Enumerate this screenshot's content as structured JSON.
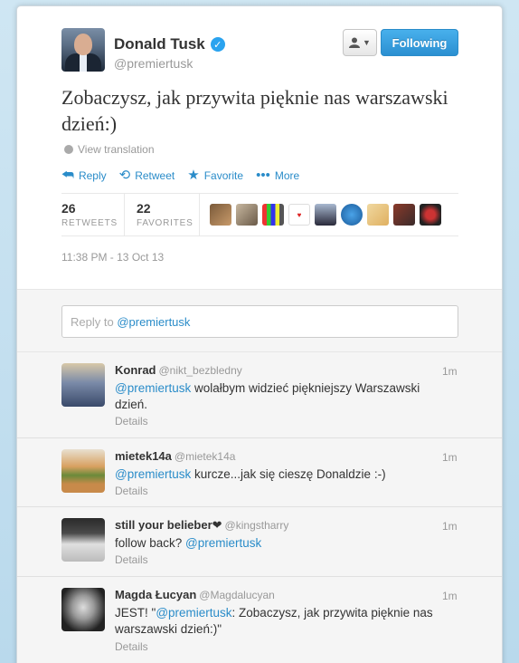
{
  "tweet": {
    "author_name": "Donald Tusk",
    "author_handle": "@premiertusk",
    "verified_mark": "✓",
    "text": "Zobaczysz, jak przywita pięknie nas warszawski dzień:)",
    "view_translation": "View translation",
    "actions": {
      "reply": "Reply",
      "retweet": "Retweet",
      "favorite": "Favorite",
      "more": "More"
    },
    "stats": {
      "retweets_count": "26",
      "retweets_label": "RETWEETS",
      "favorites_count": "22",
      "favorites_label": "FAVORITES"
    },
    "timestamp": "11:38 PM - 13 Oct 13"
  },
  "header_buttons": {
    "user_dropdown_icon": "user-icon",
    "following": "Following"
  },
  "reply_box": {
    "placeholder_prefix": "Reply to ",
    "mention": "@premiertusk"
  },
  "replies": [
    {
      "name": "Konrad",
      "handle": "@nikt_bezbledny",
      "time": "1m",
      "mention": "@premiertusk",
      "text": " wolałbym widzieć piękniejszy Warszawski dzień.",
      "details": "Details"
    },
    {
      "name": "mietek14a",
      "handle": "@mietek14a",
      "time": "1m",
      "mention": "@premiertusk",
      "text": " kurcze...jak się cieszę Donaldzie :-)",
      "details": "Details"
    },
    {
      "name": "still your belieber❤",
      "handle": "@kingstharry",
      "time": "1m",
      "prefix": "follow back? ",
      "mention": "@premiertusk",
      "text": "",
      "details": "Details"
    },
    {
      "name": "Magda Łucyan",
      "handle": "@Magdalucyan",
      "time": "1m",
      "prefix": "JEST! \"",
      "mention": "@premiertusk",
      "text": ": Zobaczysz, jak przywita pięknie nas warszawski dzień:)\"",
      "details": "Details"
    }
  ],
  "colors": {
    "link": "#2a8cc9",
    "following_button": "#2b8fd1",
    "background": "#c0deed"
  }
}
